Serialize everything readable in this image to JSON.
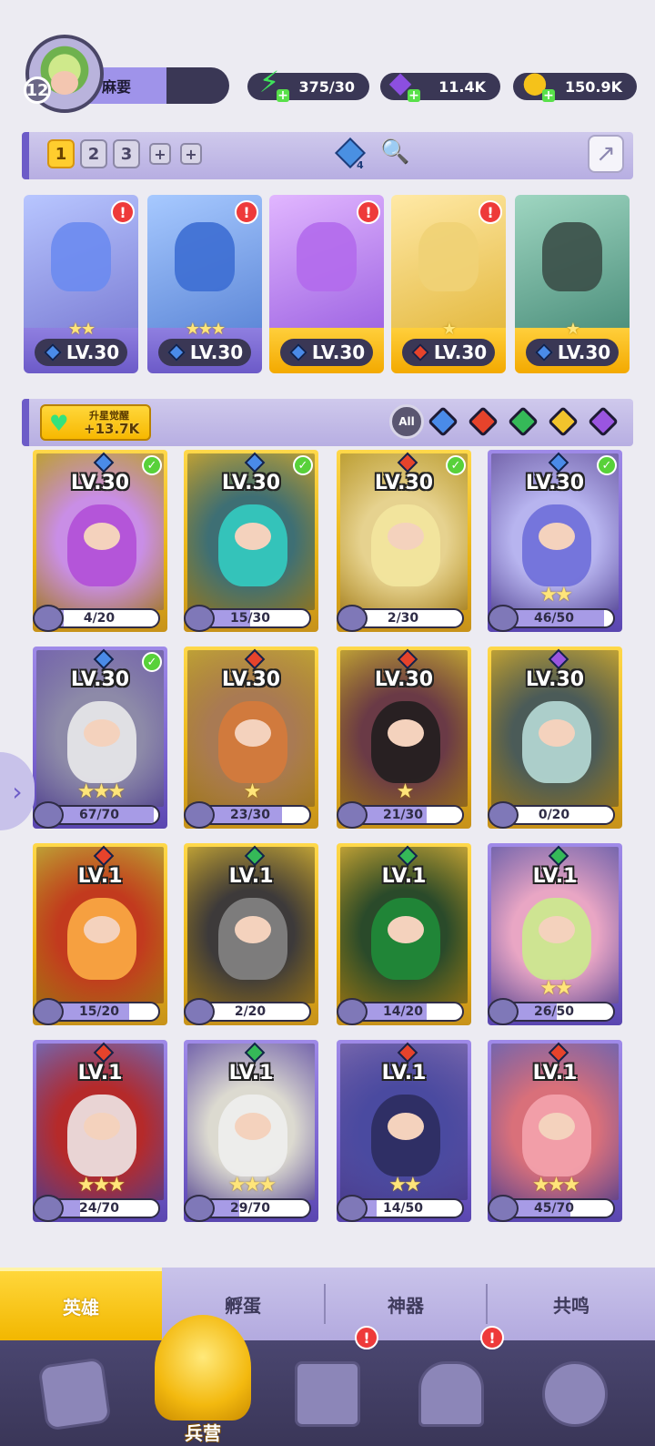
{
  "player": {
    "level": "12",
    "name": "麻要"
  },
  "resources": {
    "energy": "375/30",
    "gems": "11.4K",
    "coins": "150.9K"
  },
  "team": {
    "tabs": [
      "1",
      "2",
      "3"
    ],
    "add_labels": [
      "+",
      "+"
    ],
    "gem_count": "4",
    "cards": [
      {
        "level": "LV.30",
        "element": "water",
        "stars": "★★",
        "alert": "!",
        "foot": "purple"
      },
      {
        "level": "LV.30",
        "element": "water",
        "stars": "★★★",
        "alert": "!",
        "foot": "purple"
      },
      {
        "level": "LV.30",
        "element": "water",
        "stars": "",
        "alert": "!",
        "foot": "gold"
      },
      {
        "level": "LV.30",
        "element": "fire",
        "stars": "★",
        "alert": "!",
        "foot": "gold"
      },
      {
        "level": "LV.30",
        "element": "water",
        "stars": "★",
        "alert": "",
        "foot": "gold"
      }
    ]
  },
  "awaken": {
    "title": "升星觉醒",
    "value": "+13.7K"
  },
  "filters": {
    "all_label": "All",
    "elements": [
      "water",
      "fire",
      "nature",
      "light",
      "dark"
    ]
  },
  "heroes": [
    {
      "level": "LV.30",
      "element": "water",
      "checked": true,
      "stars": "",
      "progress": "4/20",
      "frac": 0.2,
      "frame": "gold"
    },
    {
      "level": "LV.30",
      "element": "water",
      "checked": true,
      "stars": "",
      "progress": "15/30",
      "frac": 0.5,
      "frame": "gold"
    },
    {
      "level": "LV.30",
      "element": "fire",
      "checked": true,
      "stars": "",
      "progress": "2/30",
      "frac": 0.067,
      "frame": "gold"
    },
    {
      "level": "LV.30",
      "element": "water",
      "checked": true,
      "stars": "★★",
      "progress": "46/50",
      "frac": 0.92,
      "frame": "purple"
    },
    {
      "level": "LV.30",
      "element": "water",
      "checked": true,
      "stars": "★★★",
      "progress": "67/70",
      "frac": 0.957,
      "frame": "purple"
    },
    {
      "level": "LV.30",
      "element": "fire",
      "checked": false,
      "stars": "★",
      "progress": "23/30",
      "frac": 0.767,
      "frame": "gold"
    },
    {
      "level": "LV.30",
      "element": "fire",
      "checked": false,
      "stars": "★",
      "progress": "21/30",
      "frac": 0.7,
      "frame": "gold"
    },
    {
      "level": "LV.30",
      "element": "dark",
      "checked": false,
      "stars": "",
      "progress": "0/20",
      "frac": 0.0,
      "frame": "gold"
    },
    {
      "level": "LV.1",
      "element": "fire",
      "checked": false,
      "stars": "",
      "progress": "15/20",
      "frac": 0.75,
      "frame": "gold"
    },
    {
      "level": "LV.1",
      "element": "nature",
      "checked": false,
      "stars": "",
      "progress": "2/20",
      "frac": 0.1,
      "frame": "gold"
    },
    {
      "level": "LV.1",
      "element": "nature",
      "checked": false,
      "stars": "",
      "progress": "14/20",
      "frac": 0.7,
      "frame": "gold"
    },
    {
      "level": "LV.1",
      "element": "nature",
      "checked": false,
      "stars": "★★",
      "progress": "26/50",
      "frac": 0.52,
      "frame": "purple"
    },
    {
      "level": "LV.1",
      "element": "fire",
      "checked": false,
      "stars": "★★★",
      "progress": "24/70",
      "frac": 0.343,
      "frame": "purple"
    },
    {
      "level": "LV.1",
      "element": "nature",
      "checked": false,
      "stars": "★★★",
      "progress": "29/70",
      "frac": 0.414,
      "frame": "purple"
    },
    {
      "level": "LV.1",
      "element": "fire",
      "checked": false,
      "stars": "★★",
      "progress": "14/50",
      "frac": 0.28,
      "frame": "purple"
    },
    {
      "level": "LV.1",
      "element": "fire",
      "checked": false,
      "stars": "★★★",
      "progress": "45/70",
      "frac": 0.643,
      "frame": "purple"
    }
  ],
  "subtabs": [
    "英雄",
    "孵蛋",
    "神器",
    "共鸣"
  ],
  "bottom_nav": {
    "barracks_label": "兵营",
    "alert": "!"
  },
  "colors": {
    "water": "#4a8be8",
    "fire": "#e6432b",
    "nature": "#35b958",
    "light": "#f2c42c",
    "dark": "#9a55e0",
    "accent_gold": "#ffcd2e",
    "accent_purple": "#7a63d0"
  }
}
